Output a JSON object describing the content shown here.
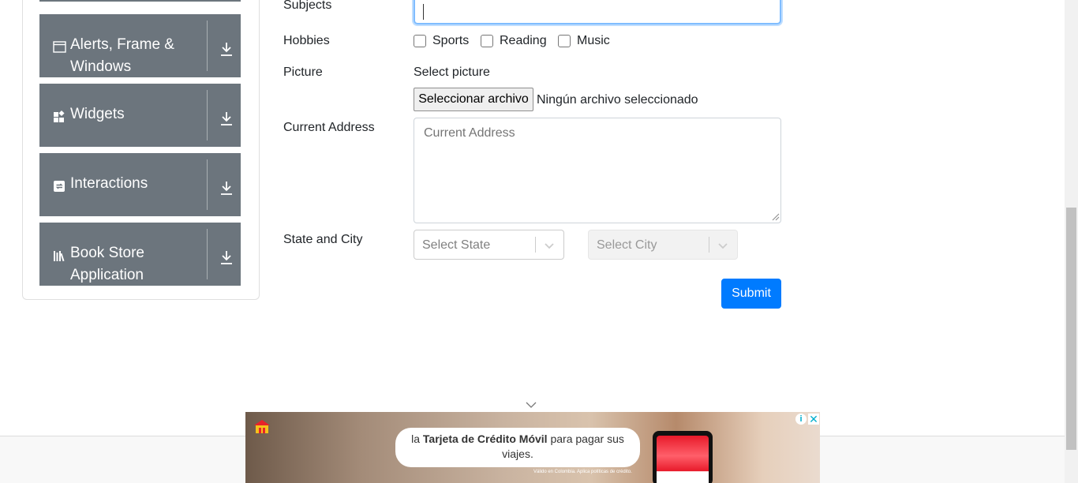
{
  "sidebar": {
    "groups": [
      {
        "label_line1": "Alerts, Frame &",
        "label_line2": "Windows",
        "icon": "window-icon"
      },
      {
        "label": "Widgets",
        "icon": "widgets-icon"
      },
      {
        "label": "Interactions",
        "icon": "interactions-icon"
      },
      {
        "label_line1": "Book Store",
        "label_line2": "Application",
        "icon": "book-store-icon"
      }
    ]
  },
  "form": {
    "subjects_label": "Subjects",
    "hobbies_label": "Hobbies",
    "hobbies": [
      "Sports",
      "Reading",
      "Music"
    ],
    "picture_label": "Picture",
    "select_picture": "Select picture",
    "file_button": "Seleccionar archivo",
    "file_status": "Ningún archivo seleccionado",
    "address_label": "Current Address",
    "address_placeholder": "Current Address",
    "state_city_label": "State and City",
    "state_placeholder": "Select State",
    "city_placeholder": "Select City",
    "submit_label": "Submit"
  },
  "ad": {
    "text_pre": "la ",
    "text_bold": "Tarjeta de Crédito Móvil",
    "text_post": " para pagar sus viajes.",
    "fine_print": "Válido en Colombia. Aplica políticas de crédito.",
    "info_glyph": "i",
    "close_glyph": "✕"
  },
  "colors": {
    "sidebar_group": "#6c757d",
    "primary": "#007bff",
    "focus_border": "#80bdff"
  }
}
